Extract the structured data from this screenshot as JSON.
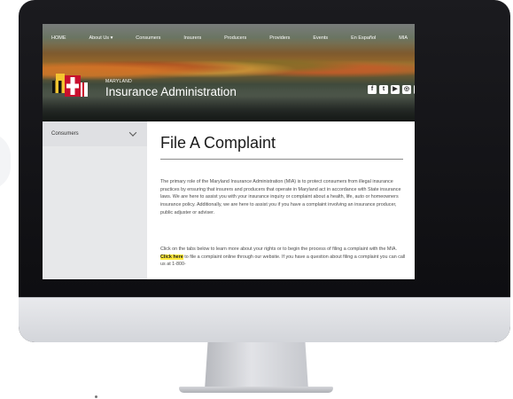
{
  "nav": {
    "items": [
      "HOME",
      "About Us ▾",
      "Consumers",
      "Insurers",
      "Producers",
      "Providers",
      "Events",
      "En Español",
      "MIA"
    ]
  },
  "brand": {
    "state_label": "MARYLAND",
    "site_title": "Insurance Administration"
  },
  "social": {
    "icons": [
      "facebook-icon",
      "twitter-icon",
      "youtube-icon",
      "instagram-icon",
      "linkedin-icon"
    ],
    "glyphs": [
      "f",
      "t",
      "▶",
      "◎",
      "in"
    ]
  },
  "sidebar": {
    "items": [
      {
        "label": "Consumers"
      }
    ]
  },
  "page": {
    "title": "File A Complaint",
    "paragraph1": "The primary role of the Maryland Insurance Administration (MIA) is to protect consumers from illegal insurance practices by ensuring that insurers and producers that operate in Maryland act in accordance with State insurance laws. We are here to assist you with your insurance inquiry or complaint about a health, life, auto or homeowners insurance policy. Additionally, we are here to assist you if you have a complaint involving an insurance producer, public adjuster or adviser.",
    "paragraph2_before": "Click on the tabs below to learn more about your rights or to begin the process of filing a complaint with the MIA.",
    "paragraph2_link": "Click here",
    "paragraph2_after": "to file a complaint online through our website. If you have a question about filing a complaint you can call us at 1-800-"
  },
  "colors": {
    "highlight": "#ffeb3b",
    "sidebar_bg": "#e7e8ea",
    "bezel": "#121215",
    "chin": "#e1e2e6"
  }
}
